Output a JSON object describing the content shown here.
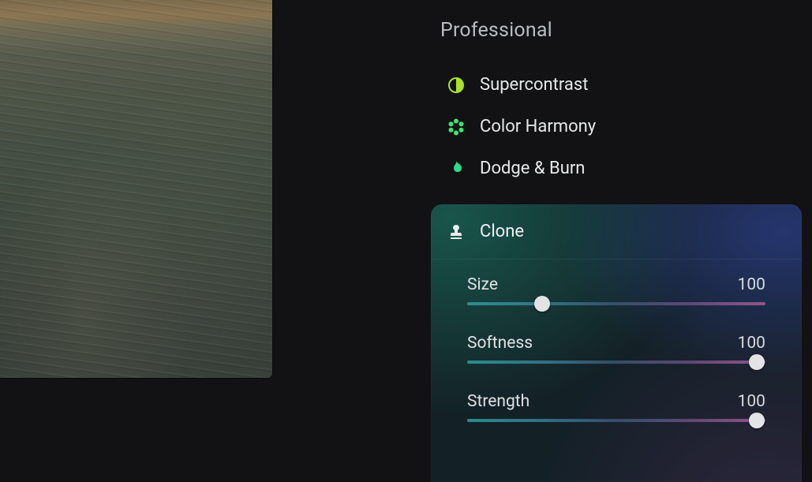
{
  "section_title": "Professional",
  "tools": {
    "supercontrast": {
      "label": "Supercontrast",
      "icon_color": "#a9e22b"
    },
    "color_harmony": {
      "label": "Color Harmony",
      "icon_color": "#3de277"
    },
    "dodge_burn": {
      "label": "Dodge & Burn",
      "icon_color": "#2fd98c"
    },
    "clone": {
      "label": "Clone"
    }
  },
  "sliders": {
    "size": {
      "label": "Size",
      "value": "100",
      "thumb_pct": 25
    },
    "softness": {
      "label": "Softness",
      "value": "100",
      "thumb_pct": 97
    },
    "strength": {
      "label": "Strength",
      "value": "100",
      "thumb_pct": 97
    }
  }
}
